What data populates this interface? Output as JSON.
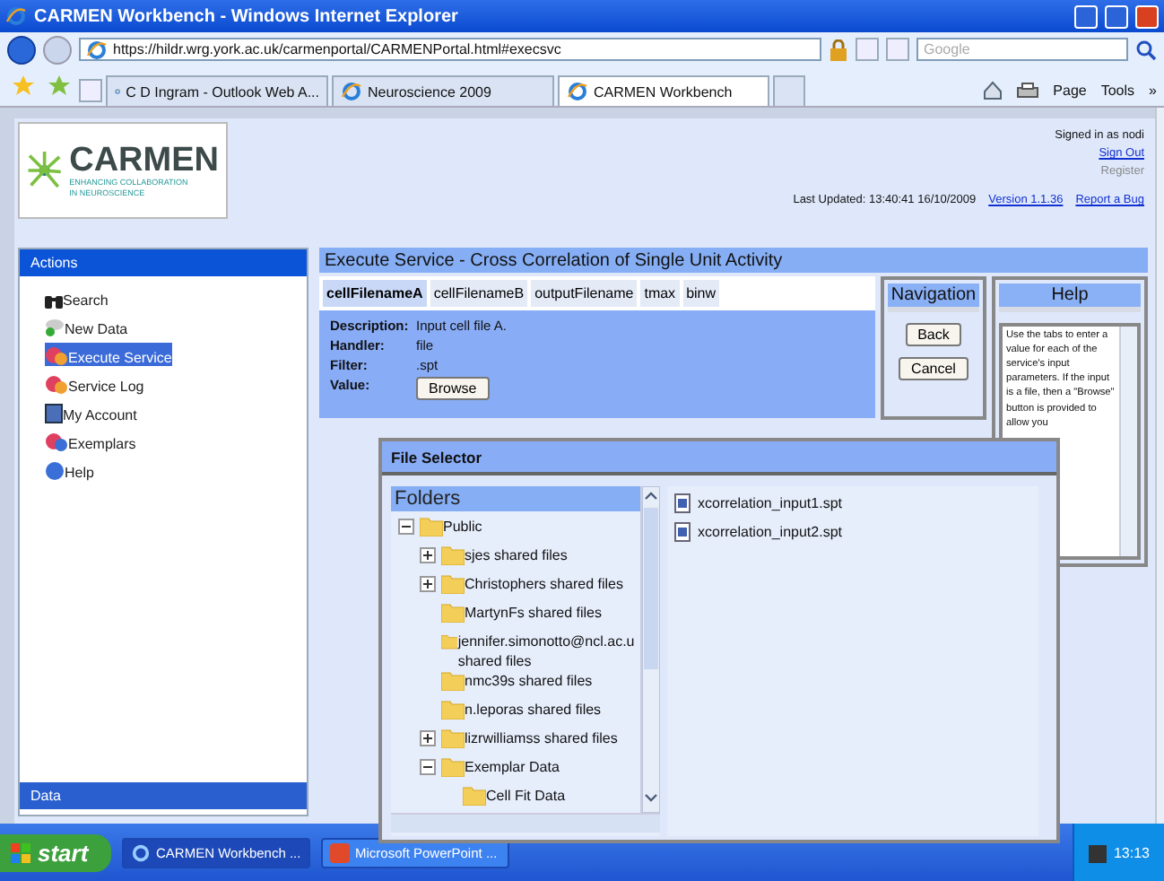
{
  "window": {
    "title": "CARMEN Workbench - Windows Internet Explorer"
  },
  "address_bar": {
    "url": "https://hildr.wrg.york.ac.uk/carmenportal/CARMENPortal.html#execsvc"
  },
  "search": {
    "placeholder": "Google"
  },
  "browser_tabs": [
    {
      "label": "C D Ingram - Outlook Web A...",
      "selected": false
    },
    {
      "label": "Neuroscience 2009",
      "selected": false
    },
    {
      "label": "CARMEN Workbench",
      "selected": true
    }
  ],
  "command_bar": [
    "Page",
    "Tools"
  ],
  "chevron": "»",
  "logo": {
    "name": "CARMEN",
    "tagline": [
      "ENHANCING COLLABORATION",
      "IN NEUROSCIENCE"
    ]
  },
  "header": {
    "user": "Signed in as nodi",
    "links": [
      {
        "label": "Sign Out",
        "disabled": false
      },
      {
        "label": "Register",
        "disabled": true
      }
    ],
    "last_updated": "Last Updated: 13:40:41 16/10/2009",
    "version": "Version 1.1.36",
    "report": "Report a Bug"
  },
  "sidebar": {
    "title": "Actions",
    "items": [
      {
        "label": "Search",
        "kind": "search",
        "selected": false
      },
      {
        "label": "New Data",
        "kind": "new",
        "selected": false
      },
      {
        "label": "Execute Service",
        "kind": "execute",
        "selected": true
      },
      {
        "label": "Service Log",
        "kind": "log",
        "selected": false
      },
      {
        "label": "My Account",
        "kind": "account",
        "selected": false
      },
      {
        "label": "Exemplars",
        "kind": "exemplars",
        "selected": false
      },
      {
        "label": "Help",
        "kind": "help",
        "selected": false
      }
    ],
    "footer": "Data"
  },
  "service": {
    "title": "Execute Service - Cross Correlation of Single Unit Activity",
    "tabs": [
      {
        "label": "cellFilenameA",
        "selected": true
      },
      {
        "label": "cellFilenameB",
        "selected": false
      },
      {
        "label": "outputFilename",
        "selected": false
      },
      {
        "label": "tmax",
        "selected": false
      },
      {
        "label": "binw",
        "selected": false
      }
    ],
    "fields": [
      {
        "label": "Description:",
        "kind": "text",
        "value": "Input cell file A."
      },
      {
        "label": "Handler:",
        "kind": "text",
        "value": "file"
      },
      {
        "label": "Filter:",
        "kind": "text",
        "value": ".spt"
      },
      {
        "label": "Value:",
        "kind": "button",
        "value": "Browse"
      }
    ]
  },
  "navigation": {
    "title": "Navigation",
    "buttons": [
      "Back",
      "Cancel"
    ]
  },
  "help": {
    "title": "Help",
    "text": "Use the tabs to enter a value for each of the service's input parameters. If the input is a file, then a \"Browse\" button is provided to allow you"
  },
  "file_selector": {
    "title": "File Selector",
    "folders_title": "Folders",
    "tree": [
      {
        "label": "Public",
        "expanded": true,
        "children": [
          {
            "label": "sjes shared files",
            "expanded": false
          },
          {
            "label": "Christophers shared files",
            "expanded": false
          },
          {
            "label": "MartynFs shared files"
          },
          {
            "label": "jennifer.simonotto@ncl.ac.u shared files"
          },
          {
            "label": "nmc39s shared files"
          },
          {
            "label": "n.leporas shared files"
          },
          {
            "label": "lizrwilliamss shared files",
            "expanded": false
          },
          {
            "label": "Exemplar Data",
            "expanded": true,
            "children": [
              {
                "label": "Cell Fit Data"
              }
            ]
          }
        ]
      }
    ],
    "files": [
      "xcorrelation_input1.spt",
      "xcorrelation_input2.spt"
    ]
  },
  "taskbar": {
    "start": "start",
    "tasks": [
      {
        "label": "CARMEN Workbench ...",
        "kind": "ie",
        "selected": true
      },
      {
        "label": "Microsoft PowerPoint ...",
        "kind": "ppt",
        "selected": false
      }
    ],
    "clock": "13:13"
  }
}
